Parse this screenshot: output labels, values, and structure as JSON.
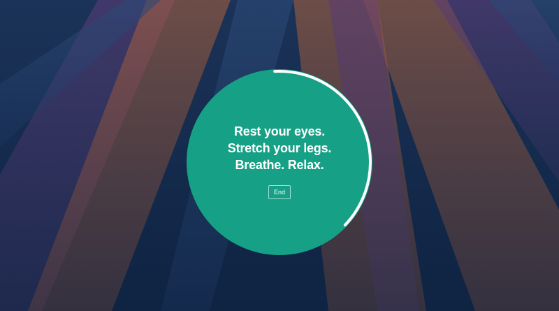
{
  "break_screen": {
    "message_lines": [
      "Rest your eyes.",
      "Stretch your legs.",
      "Breathe. Relax."
    ],
    "end_button_label": "End",
    "progress_fraction": 0.38,
    "colors": {
      "circle": "#16a085",
      "ring": "#ffffff",
      "background": "#14294a"
    }
  }
}
